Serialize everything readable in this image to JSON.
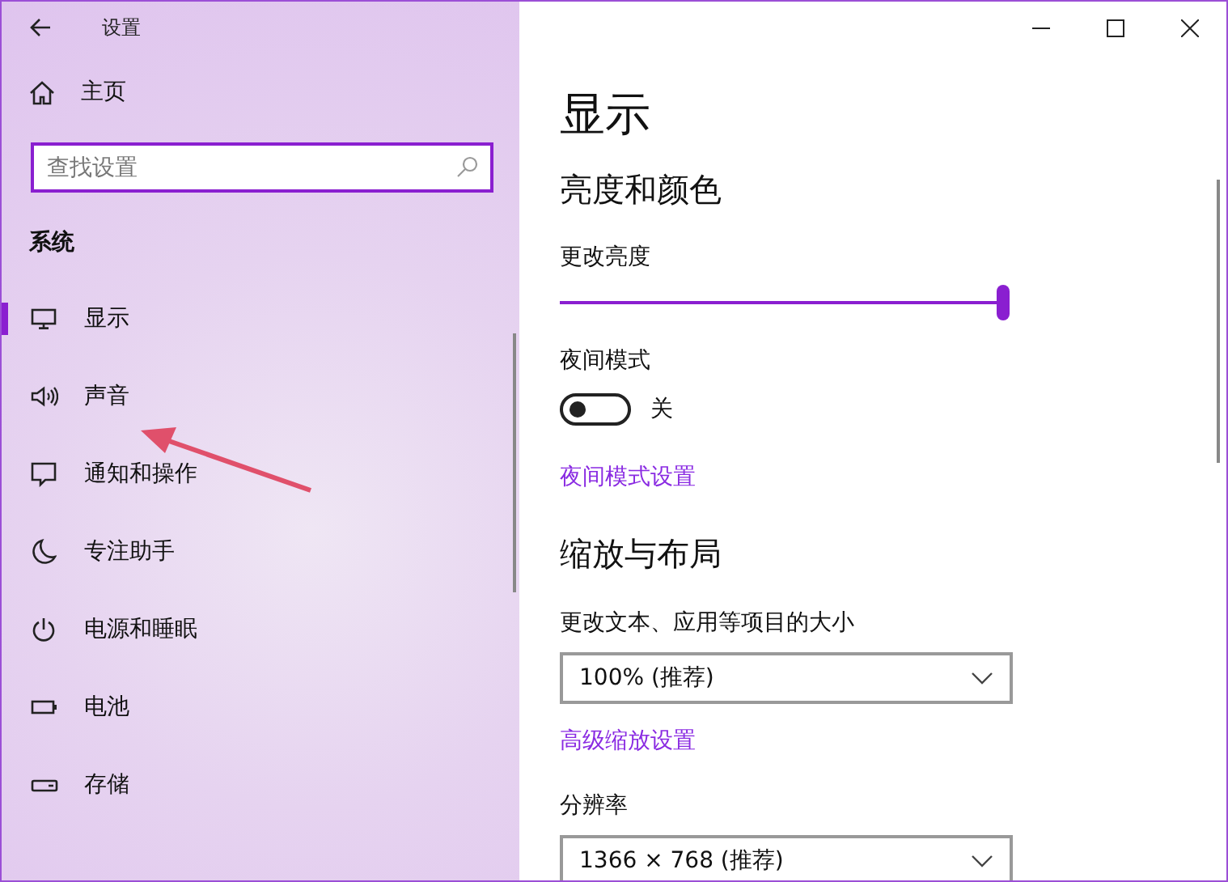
{
  "window": {
    "title": "设置"
  },
  "sidebar": {
    "home": "主页",
    "search": {
      "placeholder": "查找设置"
    },
    "section": "系统",
    "items": [
      {
        "label": "显示",
        "selected": true
      },
      {
        "label": "声音",
        "selected": false
      },
      {
        "label": "通知和操作",
        "selected": false
      },
      {
        "label": "专注助手",
        "selected": false
      },
      {
        "label": "电源和睡眠",
        "selected": false
      },
      {
        "label": "电池",
        "selected": false
      },
      {
        "label": "存储",
        "selected": false
      }
    ]
  },
  "content": {
    "title": "显示",
    "sections": [
      {
        "heading": "亮度和颜色",
        "settings": [
          {
            "kind": "slider",
            "label": "更改亮度",
            "level": 1
          },
          {
            "kind": "toggle",
            "label": "夜间模式",
            "on": false,
            "state_text": "关"
          },
          {
            "kind": "link",
            "label": "夜间模式设置"
          }
        ]
      },
      {
        "heading": "缩放与布局",
        "settings": [
          {
            "kind": "dropdown",
            "label": "更改文本、应用等项目的大小",
            "value": "100% (推荐)"
          },
          {
            "kind": "link",
            "label": "高级缩放设置"
          },
          {
            "kind": "dropdown",
            "label": "分辨率",
            "value": "1366 × 768 (推荐)"
          }
        ]
      }
    ]
  }
}
